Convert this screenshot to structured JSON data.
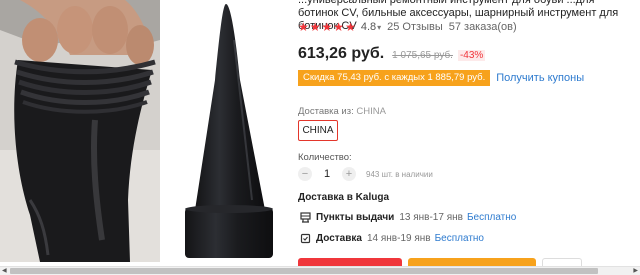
{
  "product": {
    "title": "...универсальный ремонтный инструмент для обуви ...для ботинок CV, бильные аксессуары, шарнирный инструмент для ботинок CV",
    "rating": "4.8",
    "reviews": "25 Отзывы",
    "orders": "57 заказа(ов)",
    "price": "613,26 руб.",
    "old_price": "1 075,65 руб.",
    "discount": "-43%"
  },
  "coupon": {
    "banner": "Скидка 75,43 руб. с каждых 1 885,79 руб.",
    "link": "Получить купоны"
  },
  "shipping_from": {
    "label": "Доставка из:",
    "value": "CHINA",
    "option": "CHINA"
  },
  "quantity": {
    "label": "Количество:",
    "minus": "−",
    "value": "1",
    "plus": "+",
    "stock": "943 шт. в наличии"
  },
  "delivery": {
    "title": "Доставка в Kaluga",
    "options": [
      {
        "icon": "pickup-point-icon",
        "name": "Пункты выдачи",
        "dates": "13 янв-17 янв",
        "price": "Бесплатно"
      },
      {
        "icon": "delivery-truck-icon",
        "name": "Доставка",
        "dates": "14 янв-19 янв",
        "price": "Бесплатно"
      }
    ]
  },
  "colors": {
    "accent_red": "#f0363b",
    "accent_orange": "#f7a21c",
    "link_blue": "#2e7bcf"
  },
  "scrollbar": {
    "left_arrow": "◀",
    "right_arrow": "▶"
  }
}
